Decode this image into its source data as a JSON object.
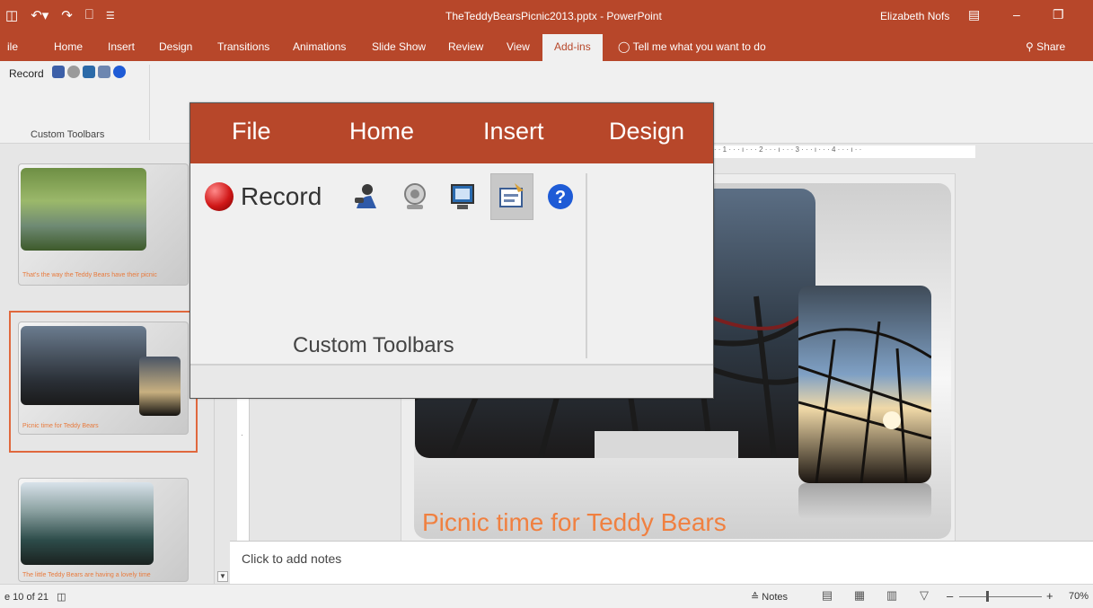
{
  "window": {
    "title": "TheTeddyBearsPicnic2013.pptx  -  PowerPoint",
    "user": "Elizabeth Nofs"
  },
  "tabs": [
    {
      "label": "ile"
    },
    {
      "label": "Home"
    },
    {
      "label": "Insert"
    },
    {
      "label": "Design"
    },
    {
      "label": "Transitions"
    },
    {
      "label": "Animations"
    },
    {
      "label": "Slide Show"
    },
    {
      "label": "Review"
    },
    {
      "label": "View"
    },
    {
      "label": "Add-ins"
    }
  ],
  "tell_me": "Tell me what you want to do",
  "share": "Share",
  "ribbon": {
    "record_label": "Record",
    "group_label": "Custom Toolbars"
  },
  "thumbnails": [
    {
      "caption": "That's the way the Teddy Bears have their picnic"
    },
    {
      "caption": "Picnic time for Teddy Bears"
    },
    {
      "caption": "The little Teddy Bears are having a lovely time"
    }
  ],
  "ruler": {
    "h": "· · · 1 · · · ı · · · 2 · · · ı · · · 3 · · · ı · · · 4 · · · ı · ·"
  },
  "slide": {
    "title": "Picnic time for Teddy Bears"
  },
  "notes_placeholder": "Click to add notes",
  "status": {
    "slide_label": "e 10 of 21",
    "notes_btn": "≙ Notes",
    "zoom": "70%"
  },
  "callout": {
    "tabs": [
      "File",
      "Home",
      "Insert",
      "Design"
    ],
    "record_label": "Record",
    "group_label": "Custom Toolbars"
  },
  "colors": {
    "accent": "#b7472a",
    "title_orange": "#f08040"
  }
}
